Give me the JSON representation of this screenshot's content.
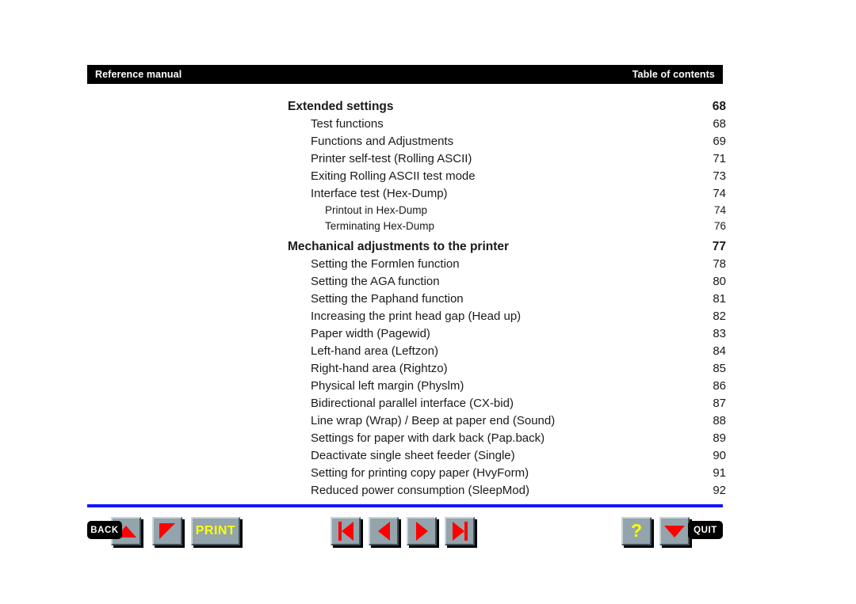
{
  "header": {
    "left_label": "Reference manual",
    "right_label": "Table of contents"
  },
  "toc": {
    "entries": [
      {
        "level": "h",
        "label": "Extended settings",
        "page": "68"
      },
      {
        "level": "1",
        "label": "Test functions",
        "page": "68"
      },
      {
        "level": "1",
        "label": "Functions and Adjustments",
        "page": "69"
      },
      {
        "level": "1",
        "label": "Printer self-test (Rolling ASCII)",
        "page": "71"
      },
      {
        "level": "1",
        "label": "Exiting Rolling ASCII test mode",
        "page": "73"
      },
      {
        "level": "1",
        "label": "Interface test (Hex-Dump)",
        "page": "74"
      },
      {
        "level": "2",
        "label": "Printout in Hex-Dump",
        "page": "74"
      },
      {
        "level": "2",
        "label": "Terminating Hex-Dump",
        "page": "76"
      },
      {
        "level": "h",
        "label": "Mechanical adjustments to the printer",
        "page": "77"
      },
      {
        "level": "1",
        "label": "Setting the Formlen function",
        "page": "78"
      },
      {
        "level": "1",
        "label": "Setting the AGA function",
        "page": "80"
      },
      {
        "level": "1",
        "label": "Setting the Paphand function",
        "page": "81"
      },
      {
        "level": "1",
        "label": "Increasing the print head gap (Head up)",
        "page": "82"
      },
      {
        "level": "1",
        "label": "Paper width (Pagewid)",
        "page": "83"
      },
      {
        "level": "1",
        "label": "Left-hand area (Leftzon)",
        "page": "84"
      },
      {
        "level": "1",
        "label": "Right-hand area (Rightzo)",
        "page": "85"
      },
      {
        "level": "1",
        "label": "Physical left margin (Physlm)",
        "page": "86"
      },
      {
        "level": "1",
        "label": "Bidirectional parallel interface (CX-bid)",
        "page": "87"
      },
      {
        "level": "1",
        "label": "Line wrap (Wrap) / Beep at paper end (Sound)",
        "page": "88"
      },
      {
        "level": "1",
        "label": "Settings for paper with dark back (Pap.back)",
        "page": "89"
      },
      {
        "level": "1",
        "label": "Deactivate single sheet feeder (Single)",
        "page": "90"
      },
      {
        "level": "1",
        "label": "Setting for printing copy paper (HvyForm)",
        "page": "91"
      },
      {
        "level": "1",
        "label": "Reduced power consumption (SleepMod)",
        "page": "92"
      }
    ]
  },
  "navbar": {
    "back_label": "BACK",
    "print_label": "PRINT",
    "quit_label": "QUIT",
    "help_label": "?",
    "buttons": {
      "scroll_up": "scroll-up",
      "scroll_down": "scroll-down",
      "first_page": "first-page",
      "previous_page": "previous-page",
      "next_page": "next-page",
      "last_page": "last-page",
      "help": "help",
      "quit_arrow": "quit-arrow"
    }
  },
  "colors": {
    "accent_red": "#ff0000",
    "accent_yellow": "#ffff00",
    "divider_blue": "#1414ff",
    "button_face": "#93a4ac",
    "header_bg": "#000000"
  }
}
